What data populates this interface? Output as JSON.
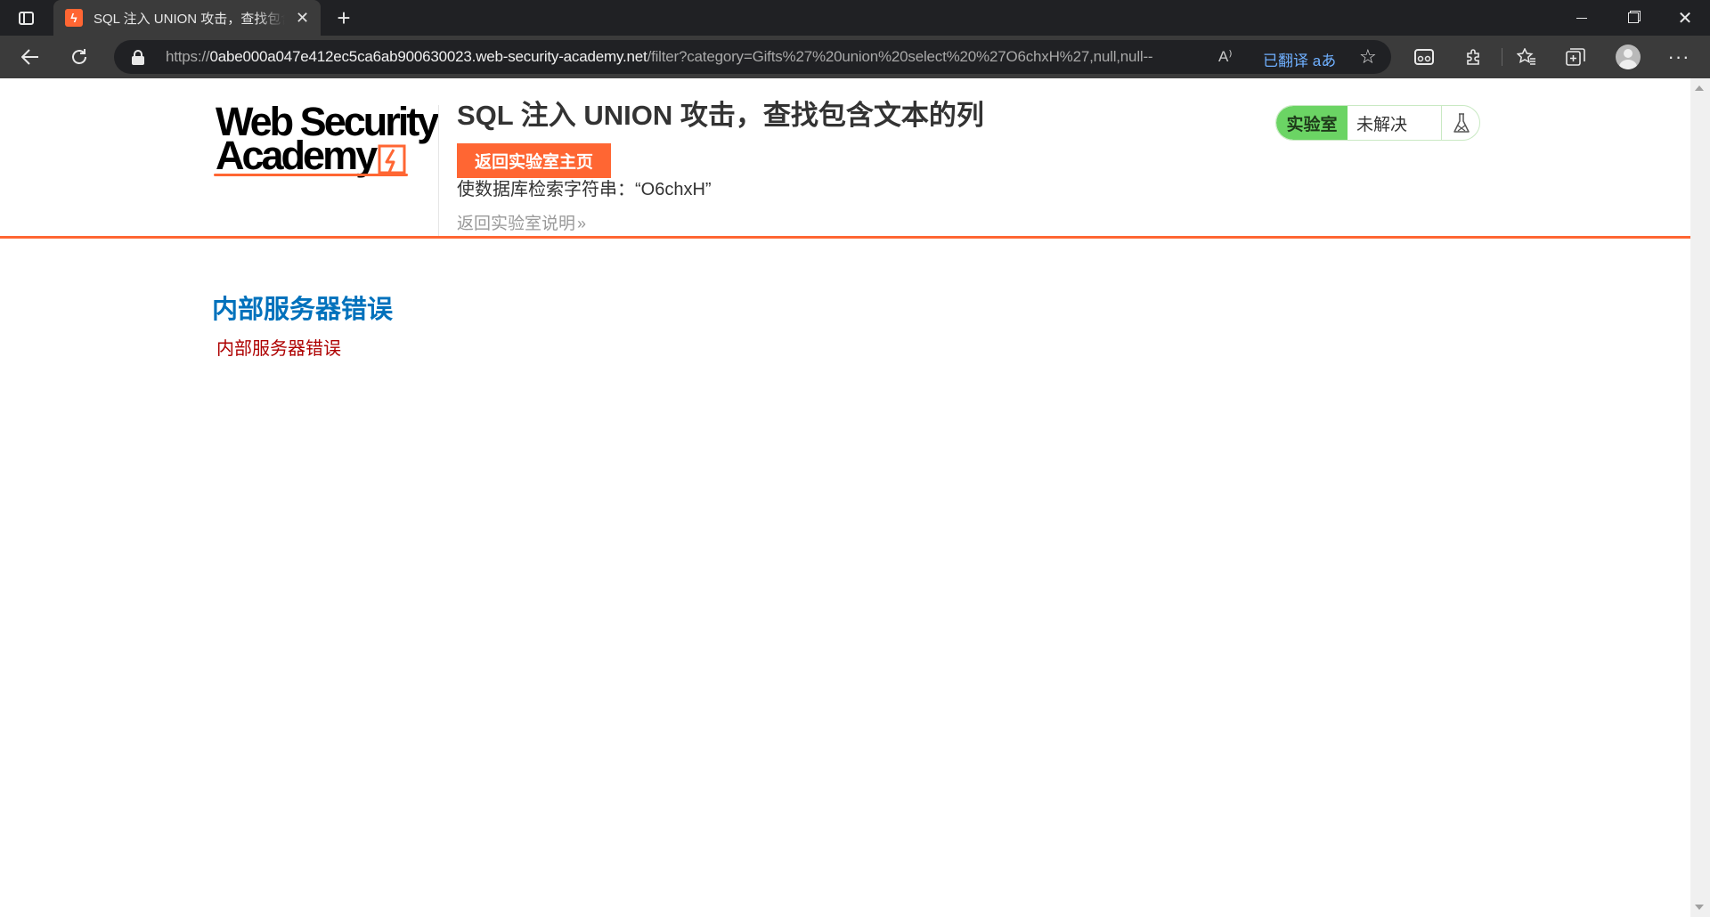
{
  "browser": {
    "tab_title": "SQL 注入 UNION 攻击，查找包含文本的列",
    "tab_favicon": "ϟ",
    "new_tab_symbol": "+",
    "url_prefix": "https://",
    "url_host": "0abe000a047e412ec5ca6ab900630023.web-security-academy.net",
    "url_path": "/filter?category=Gifts%27%20union%20select%20%27O6chxH%27,null,null--",
    "read_aloud_symbol": "A⁾",
    "translated_label": "已翻译",
    "translate_glyph": "aあ",
    "icons": [
      "tab-actions-icon",
      "close-icon",
      "back-icon",
      "reload-icon",
      "lock-icon",
      "read-aloud-icon",
      "translate-icon",
      "add-favorite-icon",
      "reading-mode-icon",
      "extensions-icon",
      "favorites-icon",
      "collections-icon",
      "profile-icon",
      "more-icon"
    ]
  },
  "page": {
    "logo_line1": "Web Security",
    "logo_line2": "Academy",
    "lab_title": "SQL 注入 UNION 攻击，查找包含文本的列",
    "back_home_label": "返回实验室主页",
    "objective": "使数据库检索字符串：“O6chxH”",
    "back_description_label": "返回实验室说明",
    "back_description_chevron": "»",
    "status_label": "实验室",
    "status_text": "未解决",
    "error_heading": "内部服务器错误",
    "error_message": "内部服务器错误"
  },
  "colors": {
    "accent": "#ff6633",
    "status_green": "#6bd464",
    "heading_blue": "#0071bc",
    "error_red": "#ae0000"
  }
}
